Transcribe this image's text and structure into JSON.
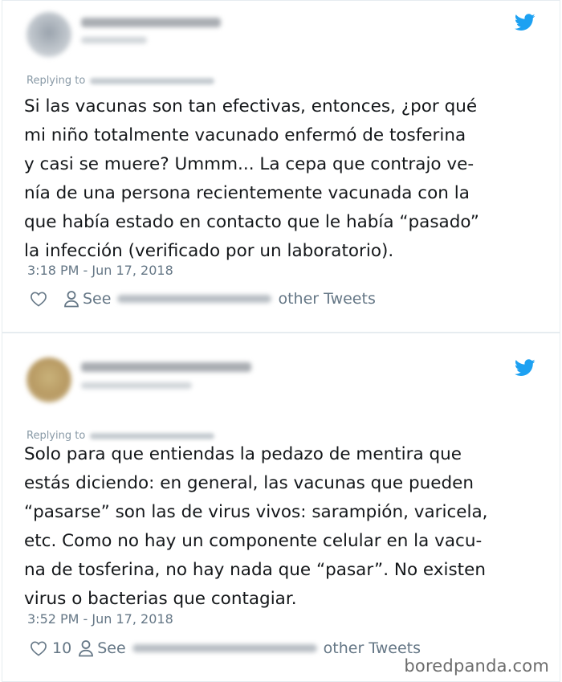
{
  "colors": {
    "twitter_blue": "#1da1f2",
    "text_primary": "#14171a",
    "text_secondary": "#657786",
    "text_muted": "#8899a6",
    "border": "#e6ecf0"
  },
  "icons": {
    "brand": "twitter-bird-icon",
    "like": "heart-outline-icon",
    "profile": "person-outline-icon"
  },
  "tweets": [
    {
      "replying_label": "Replying to",
      "text": "Si las vacunas son tan efectivas, entonces, ¿por qué\nmi niño totalmente vacunado enfermó de tosferina\ny casi se muere? Ummm... La cepa que contrajo ve-\nnía de una persona recientemente vacunada con la\nque había estado en contacto que le había “pasado”\nla infección (verificado por un laboratorio).",
      "timestamp": "3:18 PM - Jun 17, 2018",
      "likes": "",
      "see_label": "See",
      "other_tweets_label": "other Tweets"
    },
    {
      "replying_label": "Replying to",
      "text": "Solo para que entiendas la pedazo de mentira que\nestás diciendo: en general, las vacunas que pueden\n“pasarse” son las de virus vivos: sarampión, varicela,\netc. Como no hay un componente celular en la vacu-\nna de tosferina, no hay nada que “pasar”. No existen\nvirus o bacterias que contagiar.",
      "timestamp": "3:52 PM - Jun 17, 2018",
      "likes": "10",
      "see_label": "See",
      "other_tweets_label": "other Tweets"
    }
  ],
  "watermark": "boredpanda.com"
}
